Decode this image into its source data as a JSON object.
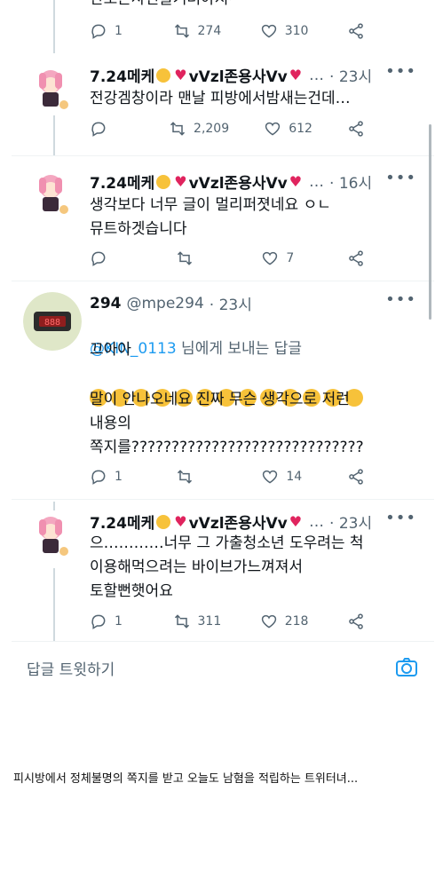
{
  "top_partial": {
    "text": "안보는사진을거려야지~",
    "replies": "1",
    "retweets": "274",
    "likes": "310"
  },
  "tweets": [
    {
      "display_name": "7.24메케",
      "name_suffix": "vVzl존용사Vv",
      "more": "…",
      "time": "· 23시",
      "text": "전강겜창이라 맨날 피방에서밤새는건데…",
      "replies": "",
      "retweets": "2,209",
      "likes": "612"
    },
    {
      "display_name": "7.24메케",
      "name_suffix": "vVzl존용사Vv",
      "more": "…",
      "time": "· 16시",
      "text": "생각보다 너무 글이 멀리퍼졋네요 ㅇㄴ\n뮤트하겟습니다",
      "replies": "",
      "retweets": "",
      "likes": "7"
    },
    {
      "display_name": "294",
      "handle": "@mpe294",
      "time": "· 23시",
      "reply_mention": "@KIN_0113",
      "reply_suffix": " 님에게 보내는 답글",
      "text": "끄아아",
      "text2": "말이 안나오네요 진짜 무슨 생각으로 저런\n내용의\n쪽지를?????????????????????????????",
      "replies": "1",
      "retweets": "",
      "likes": "14"
    },
    {
      "display_name": "7.24메케",
      "name_suffix": "vVzl존용사Vv",
      "more": "…",
      "time": "· 23시",
      "text": "으…………너무 그 가출청소년 도우려는 척\n이용해먹으려는 바이브가느껴져서\n토할뻔햇어요",
      "replies": "1",
      "retweets": "311",
      "likes": "218"
    }
  ],
  "reply_bar": {
    "label": "답글 트윗하기"
  },
  "caption": "피시방에서 정체불명의 쪽지를 받고 오늘도 남혐을 적립하는 트위터녀...",
  "colors": {
    "accent": "#1d9bf0",
    "secondary": "#536471",
    "heart": "#e0245e",
    "divider": "#eff3f4"
  }
}
